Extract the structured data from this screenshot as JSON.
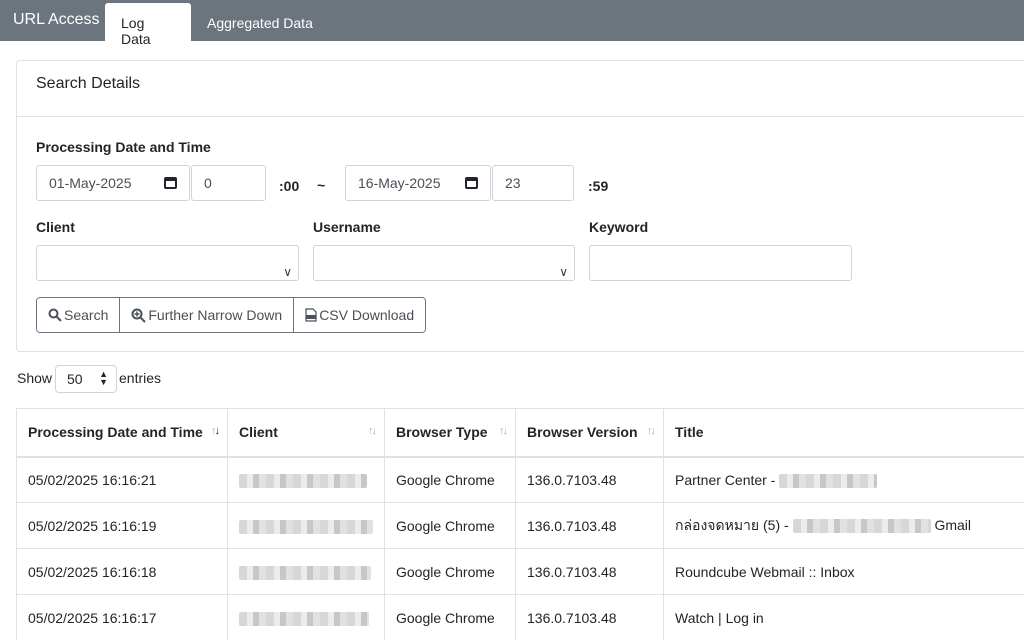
{
  "app": {
    "title": "URL Access"
  },
  "tabs": [
    {
      "label": "Log Data",
      "active": true
    },
    {
      "label": "Aggregated Data",
      "active": false
    }
  ],
  "search": {
    "header": "Search Details",
    "processing_label": "Processing Date and Time",
    "start_date": "01-May-2025",
    "start_hour": "0",
    "start_suffix": ":00",
    "range_sep": "~",
    "end_date": "16-May-2025",
    "end_hour": "23",
    "end_suffix": ":59",
    "client_label": "Client",
    "client_value": "",
    "username_label": "Username",
    "username_value": "",
    "keyword_label": "Keyword",
    "keyword_value": "",
    "buttons": {
      "search": "Search",
      "narrow": "Further Narrow Down",
      "csv": "CSV Download"
    }
  },
  "entries": {
    "show": "Show",
    "value": "50",
    "suffix": "entries"
  },
  "table": {
    "columns": [
      "Processing Date and Time",
      "Client",
      "Browser Type",
      "Browser Version",
      "Title"
    ],
    "rows": [
      {
        "datetime": "05/02/2025 16:16:21",
        "browser": "Google Chrome",
        "version": "136.0.7103.48",
        "title_prefix": "Partner Center - ",
        "title_suffix": ""
      },
      {
        "datetime": "05/02/2025 16:16:19",
        "browser": "Google Chrome",
        "version": "136.0.7103.48",
        "title_prefix": "กล่องจดหมาย (5) - ",
        "title_suffix": " Gmail"
      },
      {
        "datetime": "05/02/2025 16:16:18",
        "browser": "Google Chrome",
        "version": "136.0.7103.48",
        "title_prefix": "Roundcube Webmail :: Inbox",
        "title_suffix": ""
      },
      {
        "datetime": "05/02/2025 16:16:17",
        "browser": "Google Chrome",
        "version": "136.0.7103.48",
        "title_prefix": "Watch | Log in",
        "title_suffix": ""
      }
    ]
  },
  "colors": {
    "topbar": "#6c757d",
    "border": "#dee2e6",
    "button_border": "#6c757d"
  },
  "icons": [
    "search-icon",
    "zoom-plus-icon",
    "csv-file-icon",
    "calendar-icon",
    "chevron-down-icon",
    "sort-icon"
  ]
}
